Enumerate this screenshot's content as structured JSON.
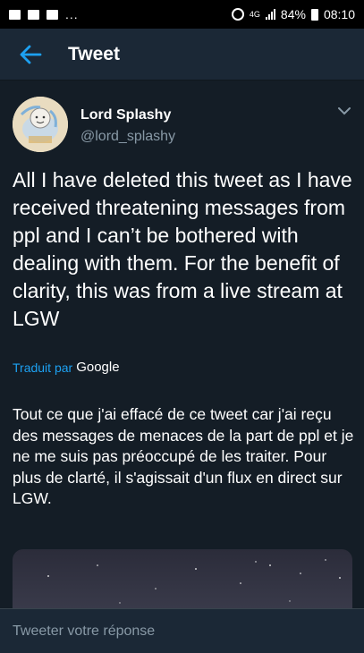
{
  "status_bar": {
    "network": "4G",
    "battery": "84%",
    "time": "08:10",
    "overflow": "..."
  },
  "app_bar": {
    "title": "Tweet"
  },
  "tweet": {
    "author_name": "Lord Splashy",
    "author_handle": "@lord_splashy",
    "text": "All I have deleted this tweet as I have received threatening messages from ppl and I can’t be bothered with dealing with them. For the benefit of clarity, this was from a live stream at LGW",
    "translated_by_label": "Traduit par",
    "translator": "Google",
    "translation": "Tout ce que j'ai effacé de ce tweet car j'ai reçu des messages de menaces de la part de ppl et je ne me suis pas préoccupé de les traiter. Pour plus de clarté, il s'agissait d'un flux en direct sur LGW."
  },
  "reply": {
    "placeholder": "Tweeter votre réponse"
  },
  "colors": {
    "background": "#141d26",
    "app_bar": "#1b2836",
    "accent": "#1da1f2",
    "secondary_text": "#8899a6"
  }
}
